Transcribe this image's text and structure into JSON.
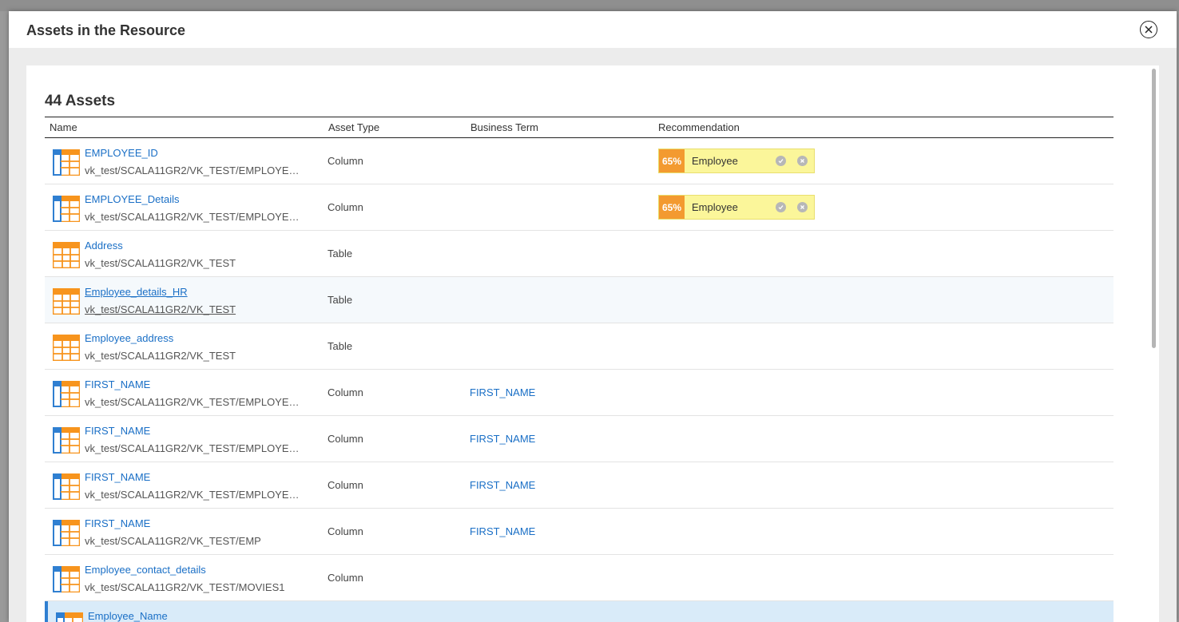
{
  "dialog": {
    "title": "Assets in the Resource",
    "close_icon": "close-circle-icon"
  },
  "assets": {
    "count_label": "44 Assets",
    "columns": {
      "name": "Name",
      "asset_type": "Asset Type",
      "business_term": "Business Term",
      "recommendation": "Recommendation"
    },
    "rows": [
      {
        "name": "EMPLOYEE_ID",
        "path": "vk_test/SCALA11GR2/VK_TEST/EMPLOYEE…",
        "type": "Column",
        "icon": "column-icon",
        "term": "",
        "rec_pct": "65%",
        "rec_term": "Employee"
      },
      {
        "name": "EMPLOYEE_Details",
        "path": "vk_test/SCALA11GR2/VK_TEST/EMPLOYEE…",
        "type": "Column",
        "icon": "column-icon",
        "term": "",
        "rec_pct": "65%",
        "rec_term": "Employee"
      },
      {
        "name": "Address",
        "path": "vk_test/SCALA11GR2/VK_TEST",
        "type": "Table",
        "icon": "table-icon",
        "term": ""
      },
      {
        "name": "Employee_details_HR",
        "path": "vk_test/SCALA11GR2/VK_TEST",
        "type": "Table",
        "icon": "table-icon",
        "term": ""
      },
      {
        "name": "Employee_address",
        "path": "vk_test/SCALA11GR2/VK_TEST",
        "type": "Table",
        "icon": "table-icon",
        "term": ""
      },
      {
        "name": "FIRST_NAME",
        "path": "vk_test/SCALA11GR2/VK_TEST/EMPLOYEE…",
        "type": "Column",
        "icon": "column-icon",
        "term": "FIRST_NAME"
      },
      {
        "name": "FIRST_NAME",
        "path": "vk_test/SCALA11GR2/VK_TEST/EMPLOYEE…",
        "type": "Column",
        "icon": "column-icon",
        "term": "FIRST_NAME"
      },
      {
        "name": "FIRST_NAME",
        "path": "vk_test/SCALA11GR2/VK_TEST/EMPLOYEE…",
        "type": "Column",
        "icon": "column-icon",
        "term": "FIRST_NAME"
      },
      {
        "name": "FIRST_NAME",
        "path": "vk_test/SCALA11GR2/VK_TEST/EMP",
        "type": "Column",
        "icon": "column-icon",
        "term": "FIRST_NAME"
      },
      {
        "name": "Employee_contact_details",
        "path": "vk_test/SCALA11GR2/VK_TEST/MOVIES1",
        "type": "Column",
        "icon": "column-icon",
        "term": ""
      },
      {
        "name": "Employee_Name",
        "path": "",
        "type": "",
        "icon": "column-icon",
        "term": ""
      }
    ],
    "recommendation_icons": {
      "accept": "check-circle-icon",
      "reject": "x-circle-icon"
    }
  },
  "colors": {
    "link": "#1a6fc6",
    "rec_chip": "#fbf69a",
    "rec_pct": "#f39a30",
    "icon_orange": "#f7941d",
    "icon_blue": "#2f7fd1",
    "selected_row": "#d9ebf9"
  }
}
